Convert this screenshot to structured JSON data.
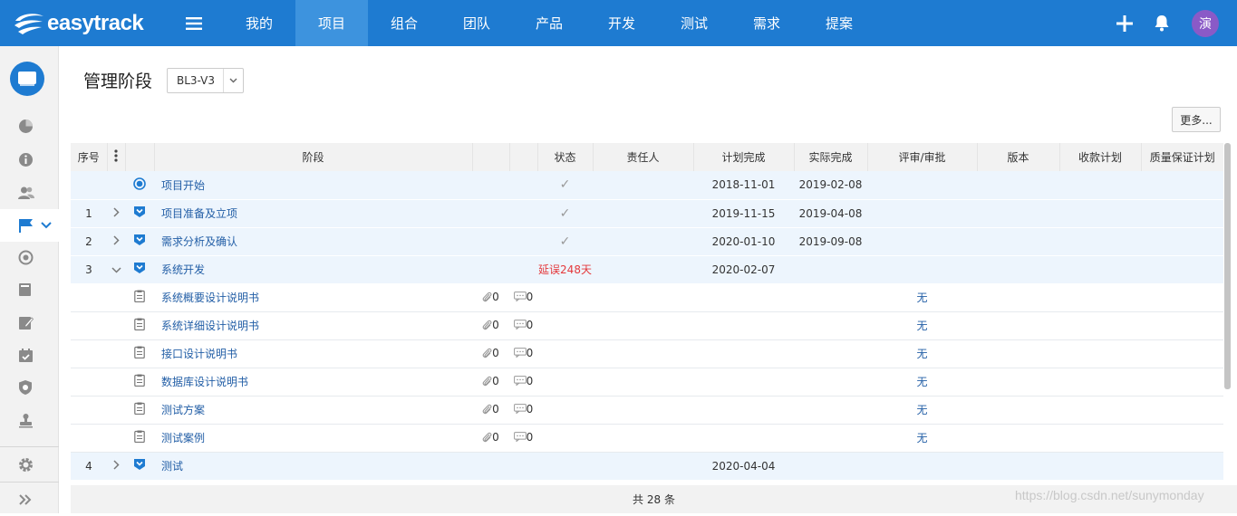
{
  "app": {
    "brand": "easytrack"
  },
  "topnav": {
    "items": [
      {
        "label": "我的"
      },
      {
        "label": "项目"
      },
      {
        "label": "组合"
      },
      {
        "label": "团队"
      },
      {
        "label": "产品"
      },
      {
        "label": "开发"
      },
      {
        "label": "测试"
      },
      {
        "label": "需求"
      },
      {
        "label": "提案"
      }
    ],
    "active_index": 1,
    "avatar_text": "演"
  },
  "colors": {
    "primary": "#1e7bd1",
    "active_nav": "#3d93de",
    "phase_row": "#edf5fd",
    "link": "#225ea6",
    "danger": "#e4393c",
    "avatar": "#8a5ac7"
  },
  "sidebar": {
    "icons": [
      "pie-chart-icon",
      "info-icon",
      "users-icon",
      "flag-icon",
      "target-icon",
      "book-icon",
      "edit-icon",
      "calendar-check-icon",
      "shield-icon",
      "stamp-icon",
      "gear-icon",
      "double-chevron-right-icon"
    ],
    "active": "flag-icon"
  },
  "page": {
    "title": "管理阶段",
    "version_select": "BL3-V3",
    "more_button": "更多..."
  },
  "table": {
    "columns": {
      "seq": "序号",
      "stage": "阶段",
      "status": "状态",
      "owner": "责任人",
      "planned": "计划完成",
      "actual": "实际完成",
      "review": "评审/审批",
      "version": "版本",
      "payment": "收款计划",
      "qa": "质量保证计划"
    },
    "rows": [
      {
        "seq": "",
        "name": "项目开始",
        "status": "✓",
        "planned": "2018-11-01",
        "actual": "2019-02-08"
      },
      {
        "seq": "1",
        "name": "项目准备及立项",
        "status": "✓",
        "planned": "2019-11-15",
        "actual": "2019-04-08"
      },
      {
        "seq": "2",
        "name": "需求分析及确认",
        "status": "✓",
        "planned": "2020-01-10",
        "actual": "2019-09-08"
      },
      {
        "seq": "3",
        "name": "系统开发",
        "status": "延误248天",
        "planned": "2020-02-07",
        "actual": ""
      },
      {
        "name": "系统概要设计说明书",
        "attach": "0",
        "comments": "0",
        "review": "无"
      },
      {
        "name": "系统详细设计说明书",
        "attach": "0",
        "comments": "0",
        "review": "无"
      },
      {
        "name": "接口设计说明书",
        "attach": "0",
        "comments": "0",
        "review": "无"
      },
      {
        "name": "数据库设计说明书",
        "attach": "0",
        "comments": "0",
        "review": "无"
      },
      {
        "name": "测试方案",
        "attach": "0",
        "comments": "0",
        "review": "无"
      },
      {
        "name": "测试案例",
        "attach": "0",
        "comments": "0",
        "review": "无"
      },
      {
        "seq": "4",
        "name": "测试",
        "status": "",
        "planned": "2020-04-04",
        "actual": ""
      }
    ]
  },
  "footer": {
    "total": "共 28 条"
  },
  "watermark": "https://blog.csdn.net/sunymonday"
}
